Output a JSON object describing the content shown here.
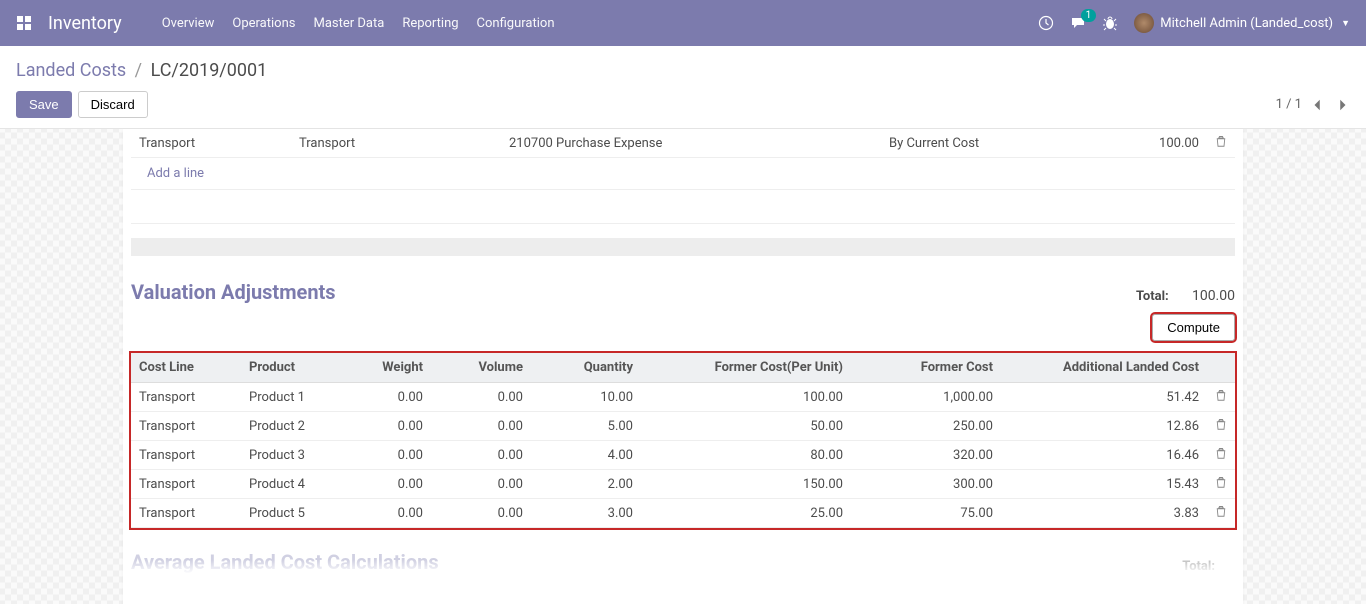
{
  "topnav": {
    "brand": "Inventory",
    "menu": [
      "Overview",
      "Operations",
      "Master Data",
      "Reporting",
      "Configuration"
    ],
    "chat_count": "1",
    "user": "Mitchell Admin (Landed_cost)"
  },
  "breadcrumb": {
    "root": "Landed Costs",
    "current": "LC/2019/0001"
  },
  "buttons": {
    "save": "Save",
    "discard": "Discard",
    "compute": "Compute"
  },
  "pager": {
    "text": "1 / 1"
  },
  "cost_lines_table": {
    "rows": [
      {
        "product": "Transport",
        "description": "Transport",
        "account": "210700 Purchase Expense",
        "split": "By Current Cost",
        "cost": "100.00"
      }
    ],
    "add_line": "Add a line"
  },
  "valuation": {
    "title": "Valuation Adjustments",
    "total_label": "Total:",
    "total_value": "100.00",
    "headers": {
      "cost_line": "Cost Line",
      "product": "Product",
      "weight": "Weight",
      "volume": "Volume",
      "quantity": "Quantity",
      "former_unit": "Former Cost(Per Unit)",
      "former_cost": "Former Cost",
      "additional": "Additional Landed Cost"
    },
    "rows": [
      {
        "cost_line": "Transport",
        "product": "Product 1",
        "weight": "0.00",
        "volume": "0.00",
        "quantity": "10.00",
        "former_unit": "100.00",
        "former_cost": "1,000.00",
        "additional": "51.42"
      },
      {
        "cost_line": "Transport",
        "product": "Product 2",
        "weight": "0.00",
        "volume": "0.00",
        "quantity": "5.00",
        "former_unit": "50.00",
        "former_cost": "250.00",
        "additional": "12.86"
      },
      {
        "cost_line": "Transport",
        "product": "Product 3",
        "weight": "0.00",
        "volume": "0.00",
        "quantity": "4.00",
        "former_unit": "80.00",
        "former_cost": "320.00",
        "additional": "16.46"
      },
      {
        "cost_line": "Transport",
        "product": "Product 4",
        "weight": "0.00",
        "volume": "0.00",
        "quantity": "2.00",
        "former_unit": "150.00",
        "former_cost": "300.00",
        "additional": "15.43"
      },
      {
        "cost_line": "Transport",
        "product": "Product 5",
        "weight": "0.00",
        "volume": "0.00",
        "quantity": "3.00",
        "former_unit": "25.00",
        "former_cost": "75.00",
        "additional": "3.83"
      }
    ]
  },
  "average_section": {
    "title": "Average Landed Cost Calculations",
    "total_label": "Total:"
  }
}
